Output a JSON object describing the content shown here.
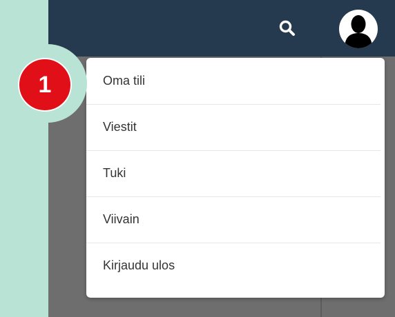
{
  "colors": {
    "page_background": "#b9e3d5",
    "topbar": "#263a4f",
    "overlay": "#6e6e6e",
    "callout_red": "#e10f17"
  },
  "topbar": {
    "search_icon": "search-icon",
    "avatar_icon": "user-silhouette-icon"
  },
  "callout": {
    "number": "1"
  },
  "menu": {
    "items": [
      {
        "label": "Oma tili"
      },
      {
        "label": "Viestit"
      },
      {
        "label": "Tuki"
      },
      {
        "label": "Viivain"
      },
      {
        "label": "Kirjaudu ulos"
      }
    ]
  }
}
